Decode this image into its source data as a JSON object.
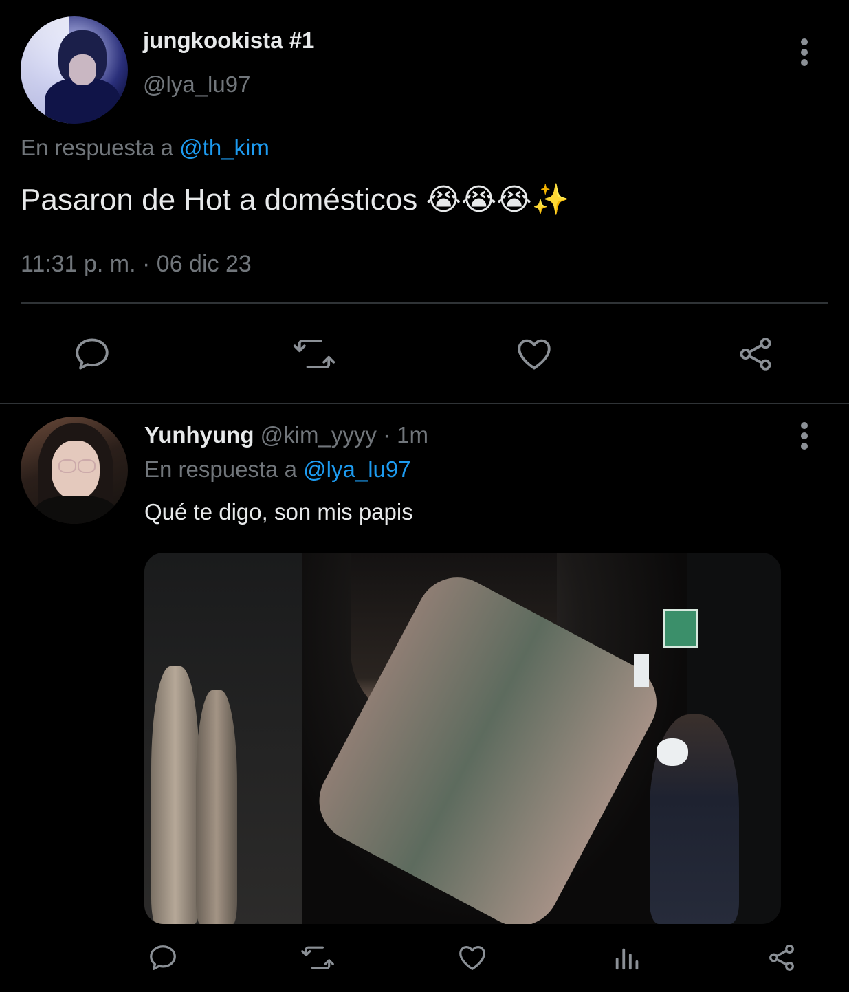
{
  "main_tweet": {
    "display_name": "jungkookista #1",
    "handle": "@lya_lu97",
    "reply_prefix": "En respuesta a",
    "reply_mention": "@th_kim",
    "text": "Pasaron de Hot a domésticos",
    "emojis": "😭😭😭✨",
    "timestamp": "11:31 p. m. · 06 dic 23",
    "avatar_icon": "avatar-photo",
    "more_icon": "more-vertical-icon",
    "actions": [
      {
        "name": "reply",
        "icon": "comment-icon"
      },
      {
        "name": "retweet",
        "icon": "retweet-icon"
      },
      {
        "name": "like",
        "icon": "heart-icon"
      },
      {
        "name": "share",
        "icon": "share-icon"
      }
    ]
  },
  "reply_tweet": {
    "display_name": "Yunhyung",
    "handle_and_time": "@kim_yyyy · 1m",
    "reply_prefix": "En respuesta a",
    "reply_mention": "@lya_lu97",
    "text": "Qué te digo, son mis papis",
    "media_description_icon": "photo",
    "actions": [
      {
        "name": "reply",
        "icon": "comment-icon"
      },
      {
        "name": "retweet",
        "icon": "retweet-icon"
      },
      {
        "name": "like",
        "icon": "heart-icon"
      },
      {
        "name": "views",
        "icon": "analytics-icon"
      },
      {
        "name": "share",
        "icon": "share-icon"
      }
    ]
  },
  "colors": {
    "background": "#000000",
    "text_primary": "#e7e9ea",
    "text_secondary": "#71767b",
    "mention": "#1d9bf0",
    "divider": "#2f3336",
    "icon": "#8b9096"
  }
}
